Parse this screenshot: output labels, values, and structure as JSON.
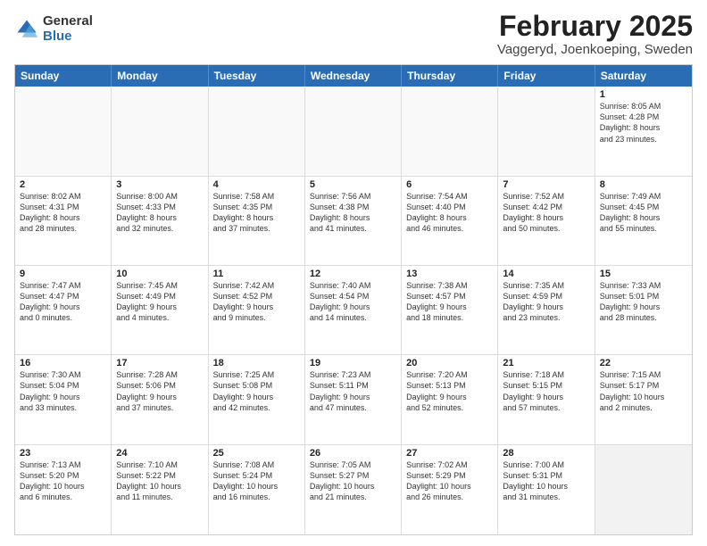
{
  "logo": {
    "general": "General",
    "blue": "Blue"
  },
  "header": {
    "title": "February 2025",
    "subtitle": "Vaggeryd, Joenkoeping, Sweden"
  },
  "weekdays": [
    "Sunday",
    "Monday",
    "Tuesday",
    "Wednesday",
    "Thursday",
    "Friday",
    "Saturday"
  ],
  "rows": [
    [
      {
        "day": "",
        "detail": "",
        "empty": true
      },
      {
        "day": "",
        "detail": "",
        "empty": true
      },
      {
        "day": "",
        "detail": "",
        "empty": true
      },
      {
        "day": "",
        "detail": "",
        "empty": true
      },
      {
        "day": "",
        "detail": "",
        "empty": true
      },
      {
        "day": "",
        "detail": "",
        "empty": true
      },
      {
        "day": "1",
        "detail": "Sunrise: 8:05 AM\nSunset: 4:28 PM\nDaylight: 8 hours\nand 23 minutes."
      }
    ],
    [
      {
        "day": "2",
        "detail": "Sunrise: 8:02 AM\nSunset: 4:31 PM\nDaylight: 8 hours\nand 28 minutes."
      },
      {
        "day": "3",
        "detail": "Sunrise: 8:00 AM\nSunset: 4:33 PM\nDaylight: 8 hours\nand 32 minutes."
      },
      {
        "day": "4",
        "detail": "Sunrise: 7:58 AM\nSunset: 4:35 PM\nDaylight: 8 hours\nand 37 minutes."
      },
      {
        "day": "5",
        "detail": "Sunrise: 7:56 AM\nSunset: 4:38 PM\nDaylight: 8 hours\nand 41 minutes."
      },
      {
        "day": "6",
        "detail": "Sunrise: 7:54 AM\nSunset: 4:40 PM\nDaylight: 8 hours\nand 46 minutes."
      },
      {
        "day": "7",
        "detail": "Sunrise: 7:52 AM\nSunset: 4:42 PM\nDaylight: 8 hours\nand 50 minutes."
      },
      {
        "day": "8",
        "detail": "Sunrise: 7:49 AM\nSunset: 4:45 PM\nDaylight: 8 hours\nand 55 minutes."
      }
    ],
    [
      {
        "day": "9",
        "detail": "Sunrise: 7:47 AM\nSunset: 4:47 PM\nDaylight: 9 hours\nand 0 minutes."
      },
      {
        "day": "10",
        "detail": "Sunrise: 7:45 AM\nSunset: 4:49 PM\nDaylight: 9 hours\nand 4 minutes."
      },
      {
        "day": "11",
        "detail": "Sunrise: 7:42 AM\nSunset: 4:52 PM\nDaylight: 9 hours\nand 9 minutes."
      },
      {
        "day": "12",
        "detail": "Sunrise: 7:40 AM\nSunset: 4:54 PM\nDaylight: 9 hours\nand 14 minutes."
      },
      {
        "day": "13",
        "detail": "Sunrise: 7:38 AM\nSunset: 4:57 PM\nDaylight: 9 hours\nand 18 minutes."
      },
      {
        "day": "14",
        "detail": "Sunrise: 7:35 AM\nSunset: 4:59 PM\nDaylight: 9 hours\nand 23 minutes."
      },
      {
        "day": "15",
        "detail": "Sunrise: 7:33 AM\nSunset: 5:01 PM\nDaylight: 9 hours\nand 28 minutes."
      }
    ],
    [
      {
        "day": "16",
        "detail": "Sunrise: 7:30 AM\nSunset: 5:04 PM\nDaylight: 9 hours\nand 33 minutes."
      },
      {
        "day": "17",
        "detail": "Sunrise: 7:28 AM\nSunset: 5:06 PM\nDaylight: 9 hours\nand 37 minutes."
      },
      {
        "day": "18",
        "detail": "Sunrise: 7:25 AM\nSunset: 5:08 PM\nDaylight: 9 hours\nand 42 minutes."
      },
      {
        "day": "19",
        "detail": "Sunrise: 7:23 AM\nSunset: 5:11 PM\nDaylight: 9 hours\nand 47 minutes."
      },
      {
        "day": "20",
        "detail": "Sunrise: 7:20 AM\nSunset: 5:13 PM\nDaylight: 9 hours\nand 52 minutes."
      },
      {
        "day": "21",
        "detail": "Sunrise: 7:18 AM\nSunset: 5:15 PM\nDaylight: 9 hours\nand 57 minutes."
      },
      {
        "day": "22",
        "detail": "Sunrise: 7:15 AM\nSunset: 5:17 PM\nDaylight: 10 hours\nand 2 minutes."
      }
    ],
    [
      {
        "day": "23",
        "detail": "Sunrise: 7:13 AM\nSunset: 5:20 PM\nDaylight: 10 hours\nand 6 minutes."
      },
      {
        "day": "24",
        "detail": "Sunrise: 7:10 AM\nSunset: 5:22 PM\nDaylight: 10 hours\nand 11 minutes."
      },
      {
        "day": "25",
        "detail": "Sunrise: 7:08 AM\nSunset: 5:24 PM\nDaylight: 10 hours\nand 16 minutes."
      },
      {
        "day": "26",
        "detail": "Sunrise: 7:05 AM\nSunset: 5:27 PM\nDaylight: 10 hours\nand 21 minutes."
      },
      {
        "day": "27",
        "detail": "Sunrise: 7:02 AM\nSunset: 5:29 PM\nDaylight: 10 hours\nand 26 minutes."
      },
      {
        "day": "28",
        "detail": "Sunrise: 7:00 AM\nSunset: 5:31 PM\nDaylight: 10 hours\nand 31 minutes."
      },
      {
        "day": "",
        "detail": "",
        "empty": true,
        "shaded": true
      }
    ]
  ]
}
